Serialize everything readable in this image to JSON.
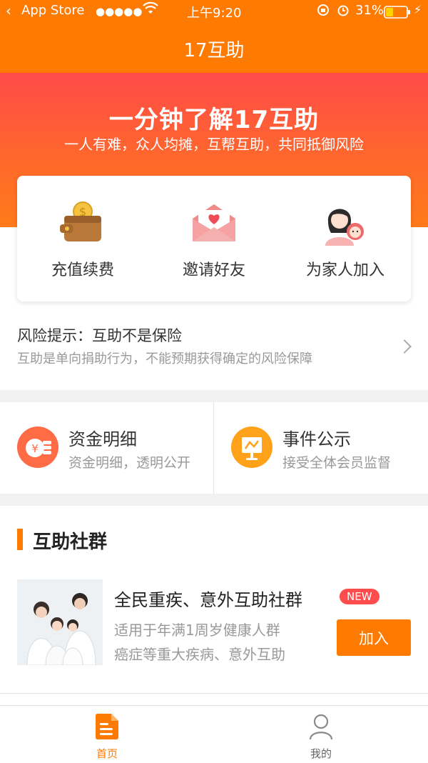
{
  "status_bar": {
    "back_app": "App Store",
    "signal": "●●●●●",
    "time": "上午9:20",
    "battery": "31%"
  },
  "nav": {
    "title": "17互助"
  },
  "banner": {
    "title": "一分钟了解17互助",
    "subtitle": "一人有难，众人均摊，互帮互助，共同抵御风险"
  },
  "quick_actions": [
    {
      "label": "充值续费",
      "icon": "wallet-icon"
    },
    {
      "label": "邀请好友",
      "icon": "envelope-heart-icon"
    },
    {
      "label": "为家人加入",
      "icon": "mother-baby-icon"
    }
  ],
  "risk": {
    "title": "风险提示：互助不是保险",
    "desc": "互助是单向捐助行为，不能预期获得确定的风险保障"
  },
  "funds": [
    {
      "title": "资金明细",
      "sub": "资金明细，透明公开",
      "icon": "coins-icon",
      "color": "#ff6b45"
    },
    {
      "title": "事件公示",
      "sub": "接受全体会员监督",
      "icon": "board-icon",
      "color": "#ffa21a"
    }
  ],
  "group": {
    "section_title": "互助社群",
    "name": "全民重疾、意外互助社群",
    "badge": "NEW",
    "desc1": "适用于年满1周岁健康人群",
    "desc2": "癌症等重大疾病、意外互助",
    "join_label": "加入"
  },
  "tabbar": [
    {
      "label": "首页",
      "icon": "home-doc-icon",
      "active": true
    },
    {
      "label": "我的",
      "icon": "person-icon",
      "active": false
    }
  ],
  "colors": {
    "accent": "#ff7a00",
    "banner_top": "#ff4a4a",
    "badge": "#ff4d4d"
  }
}
